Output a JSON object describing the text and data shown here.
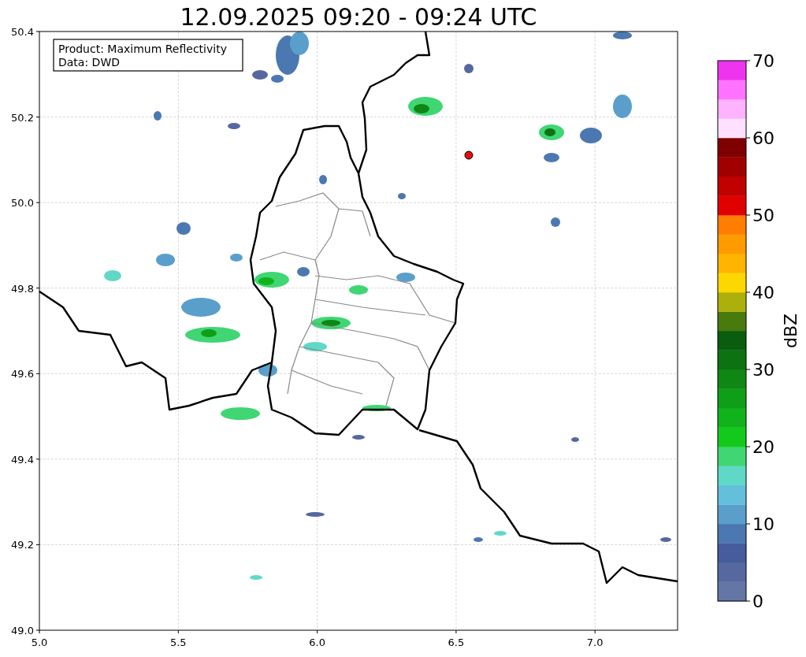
{
  "title": "12.09.2025 09:20 - 09:24 UTC",
  "info_box": [
    "Product: Maximum Reflectivity",
    "Data: DWD"
  ],
  "x_ticks": [
    "5.0",
    "5.5",
    "6.0",
    "6.5",
    "7.0"
  ],
  "y_ticks": [
    "50.4",
    "50.2",
    "50.0",
    "49.8",
    "49.6",
    "49.4",
    "49.2",
    "49.0"
  ],
  "colorbar": {
    "label": "dBZ",
    "ticks": [
      "70",
      "60",
      "50",
      "40",
      "30",
      "20",
      "10",
      "0"
    ],
    "segments": [
      {
        "color": "#6476a6"
      },
      {
        "color": "#56689f"
      },
      {
        "color": "#465c9c"
      },
      {
        "color": "#4b78b0"
      },
      {
        "color": "#5a9fcb"
      },
      {
        "color": "#64bfdd"
      },
      {
        "color": "#60d8c8"
      },
      {
        "color": "#3fd673"
      },
      {
        "color": "#13c91b"
      },
      {
        "color": "#10b41a"
      },
      {
        "color": "#0f9e17"
      },
      {
        "color": "#0e8714"
      },
      {
        "color": "#0c7212"
      },
      {
        "color": "#0a5c0f"
      },
      {
        "color": "#487a0e"
      },
      {
        "color": "#adaf0a"
      },
      {
        "color": "#ffd700"
      },
      {
        "color": "#ffb400"
      },
      {
        "color": "#ff9a00"
      },
      {
        "color": "#ff7d00"
      },
      {
        "color": "#e10000"
      },
      {
        "color": "#c10000"
      },
      {
        "color": "#a00000"
      },
      {
        "color": "#7f0000"
      },
      {
        "color": "#ffe0ff"
      },
      {
        "color": "#ffb3ff"
      },
      {
        "color": "#ff73ff"
      },
      {
        "color": "#ef34ef"
      }
    ]
  }
}
